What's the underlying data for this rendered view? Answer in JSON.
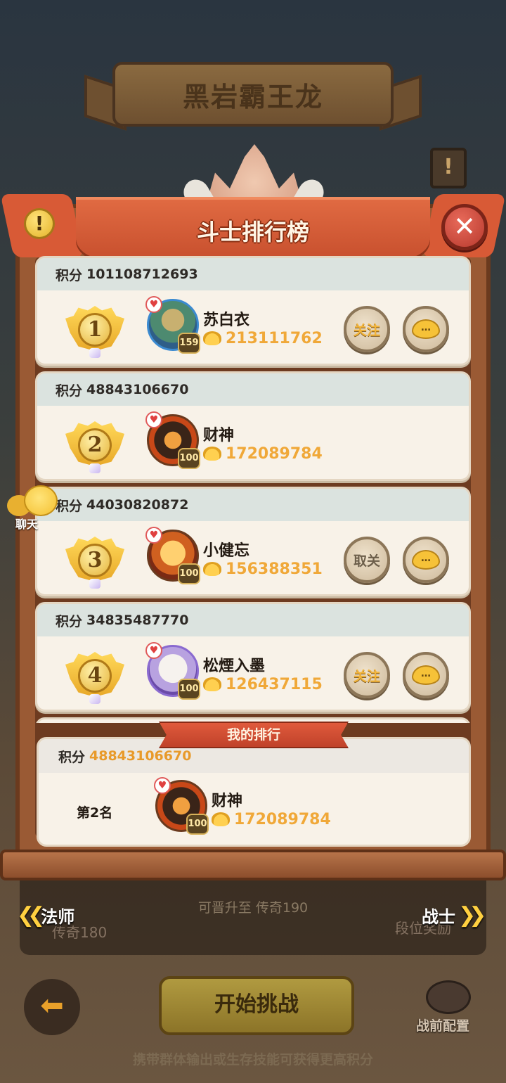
{
  "boss": {
    "title": "黑岩霸王龙"
  },
  "leaderboard": {
    "title": "斗士排行榜",
    "score_label": "积分",
    "entries": [
      {
        "rank": "1",
        "score": "101108712693",
        "name": "苏白衣",
        "level": "159",
        "gold": "213111762",
        "follow_label": "关注"
      },
      {
        "rank": "2",
        "score": "48843106670",
        "name": "财神",
        "level": "100",
        "gold": "172089784"
      },
      {
        "rank": "3",
        "score": "44030820872",
        "name": "小健忘",
        "level": "100",
        "gold": "156388351",
        "follow_label": "取关"
      },
      {
        "rank": "4",
        "score": "34835487770",
        "name": "松煙入墨",
        "level": "100",
        "gold": "126437115",
        "follow_label": "关注"
      }
    ],
    "chat_button_glyph": "…",
    "close_glyph": "✕",
    "info_glyph": "!"
  },
  "my_ranking": {
    "title": "我的排行",
    "score_label": "积分",
    "score": "48843106670",
    "rank_text": "第2名",
    "name": "财神",
    "level": "100",
    "gold": "172089784"
  },
  "chat_float": {
    "label": "聊天"
  },
  "background": {
    "promote_text": "可晋升至 传奇190",
    "left_rank": "传奇180",
    "right_label": "段位奖励",
    "nav_left": "法师",
    "nav_right": "战士",
    "start_button": "开始挑战",
    "config_label": "战前配置",
    "hint": "携带群体输出或生存技能可获得更高积分"
  },
  "colors": {
    "accent_gold": "#f0a838",
    "ribbon_red": "#e06a42",
    "panel_wood": "#9a5a34"
  }
}
